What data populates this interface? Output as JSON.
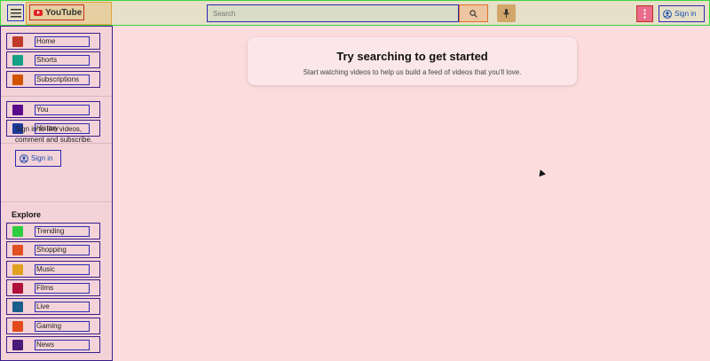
{
  "header": {
    "logo_text": "YouTube",
    "search_placeholder": "Search",
    "sign_in": "Sign in"
  },
  "sidebar": {
    "primary": [
      {
        "label": "Home",
        "icon": "home-icon",
        "color": "#c0392b"
      },
      {
        "label": "Shorts",
        "icon": "shorts-icon",
        "color": "#16a085"
      },
      {
        "label": "Subscriptions",
        "icon": "subscriptions-icon",
        "color": "#d35400"
      }
    ],
    "you": [
      {
        "label": "You",
        "icon": "you-icon",
        "color": "#5a0d8a"
      },
      {
        "label": "History",
        "icon": "history-icon",
        "color": "#1e3a9e"
      }
    ],
    "signin_text": "Sign in to like videos, comment and subscribe.",
    "signin_label": "Sign in",
    "explore_title": "Explore",
    "explore": [
      {
        "label": "Trending",
        "icon": "trending-icon",
        "color": "#2ecc40"
      },
      {
        "label": "Shopping",
        "icon": "shopping-icon",
        "color": "#e05020"
      },
      {
        "label": "Music",
        "icon": "music-icon",
        "color": "#e0a020"
      },
      {
        "label": "Films",
        "icon": "films-icon",
        "color": "#b0103a"
      },
      {
        "label": "Live",
        "icon": "live-icon",
        "color": "#1a5e8a"
      },
      {
        "label": "Gaming",
        "icon": "gaming-icon",
        "color": "#e04a1a"
      },
      {
        "label": "News",
        "icon": "news-icon",
        "color": "#4a1a7a"
      }
    ]
  },
  "main": {
    "title": "Try searching to get started",
    "subtitle": "Start watching videos to help us build a feed of videos that you'll love."
  }
}
